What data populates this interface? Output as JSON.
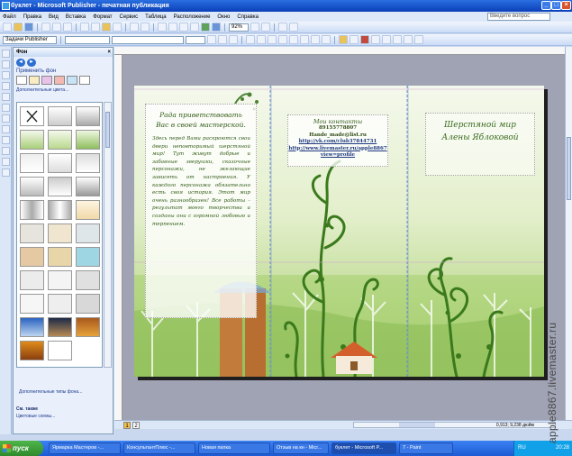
{
  "titlebar": {
    "title": "буклет - Microsoft Publisher - печатная публикация"
  },
  "menu": {
    "items": [
      "Файл",
      "Правка",
      "Вид",
      "Вставка",
      "Формат",
      "Сервис",
      "Таблица",
      "Расположение",
      "Окно",
      "Справка"
    ],
    "help_placeholder": "Введите вопрос"
  },
  "toolbar": {
    "tasks_label": "Задачи Publisher",
    "zoom": "92%"
  },
  "taskpane": {
    "title": "Фон",
    "apply_label": "Применить фон",
    "more_colors": "Дополнительные цвета...",
    "more_types": "Дополнительные типы фона...",
    "see_also": "См. также",
    "color_schemes": "Цветовые схемы..."
  },
  "document": {
    "panel1": {
      "title_line1": "Рада приветствовать",
      "title_line2": "Вас в своей мастерской.",
      "body": "Здесь перед Вами раскроются свои двери неповторимый шерстяной мир! Тут живут добрые и забавные зверушки, сказочные персонажи, не желающие зависеть от настроения. У каждого персонажа обязательно есть своя история. Этот мир очень разнообразен! Все работы – результат моего творчества и созданы они с огромной любовью и терпением."
    },
    "panel2": {
      "title": "Мои контакты",
      "phone": "89155778807",
      "email": "Hande_made@list.ru",
      "vk": "http://vk.com/club37844731",
      "lm1": "http://www.livemaster.ru/apple8867",
      "lm2": "view=profile"
    },
    "panel3": {
      "line1": "Шерстяной мир",
      "line2": "Алены Яблоковой"
    }
  },
  "statusbar": {
    "page1": "1",
    "page2": "2",
    "coords": "0,913; 9,238 дюйм"
  },
  "taskbar": {
    "start": "пуск",
    "tasks": [
      "Ярмарка Мастеров -...",
      "КонсультантПлюс -...",
      "Новая папка",
      "Отзыв на кн - Micr...",
      "буклет - Microsoft P...",
      "7 - Paint"
    ],
    "lang": "RU",
    "clock": "20:28"
  },
  "watermark": "apple8867.livemaster.ru",
  "colors": {
    "title_blue": "#0a3fb8",
    "panel_bg": "#e9f0fb",
    "workspace": "#9fa3b3",
    "accent_green": "#2f5a14"
  }
}
